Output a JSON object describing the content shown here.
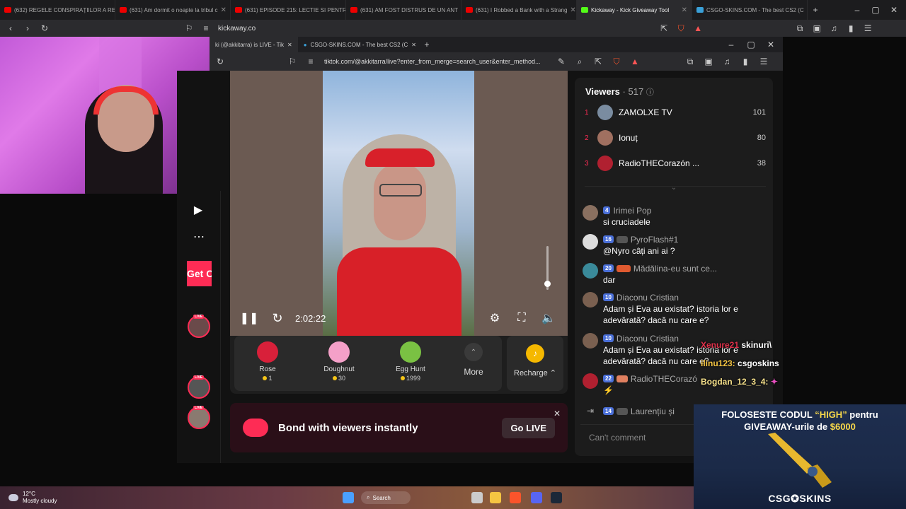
{
  "outer_tabs": [
    {
      "label": "(632) REGELE CONSPIRAȚIILOR A RE",
      "icon": "youtube-icon"
    },
    {
      "label": "(631) Am dormit o noapte la tribul c",
      "icon": "youtube-icon"
    },
    {
      "label": "(631) EPISODE 215: LECTIE SI PENTR",
      "icon": "youtube-icon"
    },
    {
      "label": "(631) AM FOST DISTRUS DE UN ANT",
      "icon": "youtube-icon"
    },
    {
      "label": "(631) I Robbed a Bank with a Strang",
      "icon": "youtube-icon"
    },
    {
      "label": "Kickaway - Kick Giveaway Tool",
      "icon": "kick-icon",
      "active": true
    },
    {
      "label": "CSGO-SKINS.COM - The best CS2 (C",
      "icon": "csgo-icon"
    }
  ],
  "outer_url": "kickaway.co",
  "inner_tabs": [
    {
      "label": "ki (@akkitarra) is LIVE - Tik",
      "active": true
    },
    {
      "label": "CSGO-SKINS.COM - The best CS2 (C"
    }
  ],
  "inner_url": "tiktok.com/@akkitarra/live?enter_from_merge=search_user&enter_method...",
  "left_rail": {
    "go_live_label": "Get C",
    "live_badge": "LIVE"
  },
  "player": {
    "time": "2:02:22",
    "volume_level": 0.15
  },
  "gifts": [
    {
      "name": "Rose",
      "price": "1",
      "color": "#d8203a"
    },
    {
      "name": "Doughnut",
      "price": "30",
      "color": "#f4a0c8"
    },
    {
      "name": "Egg Hunt",
      "price": "1999",
      "color": "#7ac143"
    }
  ],
  "more_label": "More",
  "recharge_label": "Recharge",
  "banner": {
    "text": "Bond with viewers instantly",
    "button": "Go LIVE"
  },
  "viewers": {
    "title": "Viewers",
    "count": "517",
    "top": [
      {
        "rank": "1",
        "name": "ZAMOLXE TV",
        "count": "101"
      },
      {
        "rank": "2",
        "name": "Ionuț",
        "count": "80"
      },
      {
        "rank": "3",
        "name": "RadioTHECorazón ...",
        "count": "38"
      }
    ]
  },
  "messages": [
    {
      "level": "4",
      "user": "Irimei Pop",
      "text": "si cruciadele"
    },
    {
      "level": "16",
      "user": "PyroFlash#1",
      "text": "@Nyro câți ani ai ?"
    },
    {
      "level": "20",
      "user": "Mădălina-eu sunt ce...",
      "text": "dar"
    },
    {
      "level": "10",
      "user": "Diaconu Cristian",
      "text": "Adam și Eva au existat? istoria lor e adevărată? dacă nu care e?"
    },
    {
      "level": "10",
      "user": "Diaconu Cristian",
      "text": "Adam și Eva au existat? istoria lor e adevărată? dacă nu care e?"
    },
    {
      "level": "22",
      "user": "RadioTHECorazó",
      "text": "⚡"
    },
    {
      "level": "14",
      "user": "Laurențiu și",
      "text": ""
    }
  ],
  "comment_placeholder": "Can't comment",
  "overlay": {
    "chat": [
      {
        "user": "Xenure21",
        "text": "skinuri\\"
      },
      {
        "user": "ilinu123:",
        "text": "csgoskins"
      },
      {
        "user": "Bogdan_12_3_4:",
        "text": ""
      }
    ],
    "headline_pre": "FOLOSESTE CODUL ",
    "code": "“HIGH”",
    "headline_post": " pentru",
    "line2_pre": "GIVEAWAY-urile de ",
    "amount": "$6000",
    "brand": "CSG✪SKINS"
  },
  "taskbar": {
    "temp": "12°C",
    "weather": "Mostly cloudy",
    "search": "Search"
  }
}
